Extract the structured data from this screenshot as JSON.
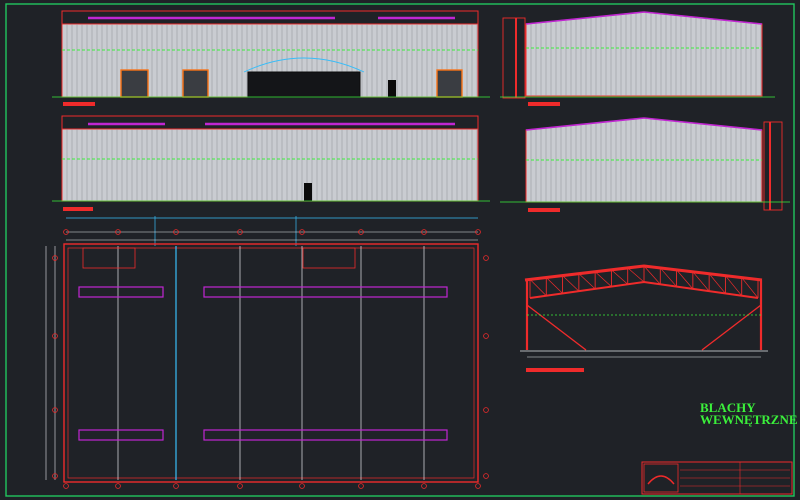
{
  "sheet": {
    "title_line_1": "BLACHY",
    "title_line_2": "WEWNĘTRZNE"
  },
  "colors": {
    "background": "#1f2227",
    "frame": "#22c55e",
    "outline": "#ef2b2b",
    "cladding": "#c9ccd1",
    "cladding_line": "#8c9097",
    "annotation": "#3bf03b",
    "beam": "#c026d3",
    "dimension": "#e5e7eb",
    "door": "#0b0b0b",
    "door_frame": "#f97316",
    "truss": "#ef2b2b",
    "title_text": "#3bf03b",
    "cyan": "#38bdf8"
  }
}
